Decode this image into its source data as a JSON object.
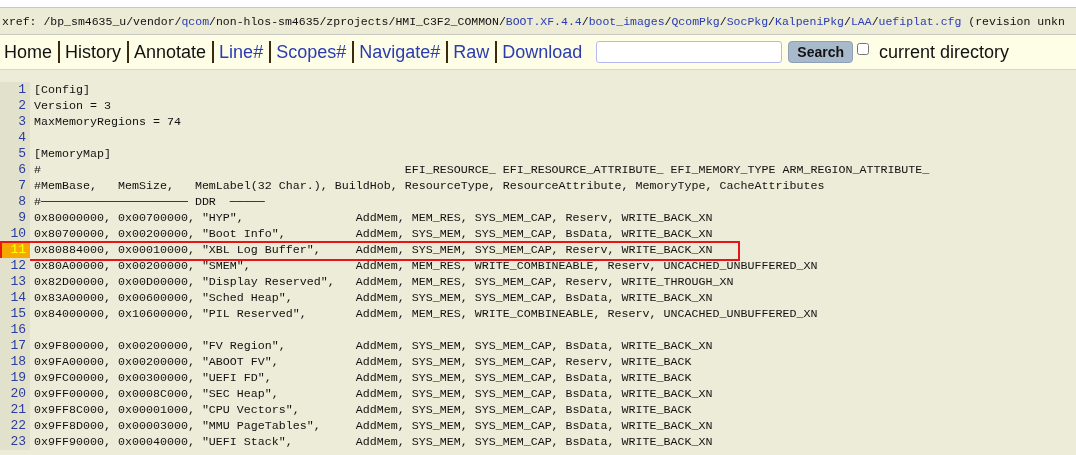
{
  "breadcrumb": [
    {
      "text": "xref: /bp_sm4635_u/vendor/",
      "link": false
    },
    {
      "text": "qcom",
      "link": true
    },
    {
      "text": "/non-hlos-sm4635/zprojects/HMI_C3F2_COMMON/",
      "link": false
    },
    {
      "text": "BOOT.XF.4.4",
      "link": true
    },
    {
      "text": "/",
      "link": false
    },
    {
      "text": "boot_images",
      "link": true
    },
    {
      "text": "/",
      "link": false
    },
    {
      "text": "QcomPkg",
      "link": true
    },
    {
      "text": "/",
      "link": false
    },
    {
      "text": "SocPkg",
      "link": true
    },
    {
      "text": "/",
      "link": false
    },
    {
      "text": "KalpeniPkg",
      "link": true
    },
    {
      "text": "/",
      "link": false
    },
    {
      "text": "LAA",
      "link": true
    },
    {
      "text": "/",
      "link": false
    },
    {
      "text": "uefiplat.cfg",
      "link": true
    },
    {
      "text": " (revision unkn",
      "link": false
    }
  ],
  "nav": [
    {
      "label": "Home",
      "link": false
    },
    {
      "label": "History",
      "link": false
    },
    {
      "label": "Annotate",
      "link": false
    },
    {
      "label": "Line#",
      "link": true
    },
    {
      "label": "Scopes#",
      "link": true
    },
    {
      "label": "Navigate#",
      "link": true
    },
    {
      "label": "Raw",
      "link": true
    },
    {
      "label": "Download",
      "link": true
    }
  ],
  "search": {
    "button": "Search",
    "checkbox_label": "current directory",
    "checked": false
  },
  "lines": [
    {
      "num": "1",
      "text": "[Config]",
      "selected": false,
      "marked": false
    },
    {
      "num": "2",
      "text": "Version = 3",
      "selected": false,
      "marked": false
    },
    {
      "num": "3",
      "text": "MaxMemoryRegions = 74",
      "selected": false,
      "marked": false
    },
    {
      "num": "4",
      "selected": false,
      "marked": false
    },
    {
      "num": "5",
      "text": "[MemoryMap]",
      "selected": false,
      "marked": false
    },
    {
      "num": "6",
      "text": "#                                                    EFI_RESOURCE_ EFI_RESOURCE_ATTRIBUTE_ EFI_MEMORY_TYPE ARM_REGION_ATTRIBUTE_",
      "selected": false,
      "marked": false
    },
    {
      "num": "7",
      "text": "#MemBase,   MemSize,   MemLabel(32 Char.), BuildHob, ResourceType, ResourceAttribute, MemoryType, CacheAttributes",
      "selected": false,
      "marked": false
    },
    {
      "num": "8",
      "text": "#───────────────────── DDR  ─────",
      "selected": false,
      "marked": false
    },
    {
      "num": "9",
      "text": "0x80000000, 0x00700000, \"HYP\",                AddMem, MEM_RES, SYS_MEM_CAP, Reserv, WRITE_BACK_XN",
      "selected": false,
      "marked": false
    },
    {
      "num": "10",
      "text": "0x80700000, 0x00200000, \"Boot Info\",          AddMem, SYS_MEM, SYS_MEM_CAP, BsData, WRITE_BACK_XN",
      "selected": false,
      "marked": false
    },
    {
      "num": "11",
      "text": "0x80884000, 0x00010000, \"XBL Log Buffer\",     AddMem, SYS_MEM, SYS_MEM_CAP, Reserv, WRITE_BACK_XN",
      "selected": true,
      "marked": true
    },
    {
      "num": "12",
      "text": "0x80A00000, 0x00200000, \"SMEM\",               AddMem, MEM_RES, WRITE_COMBINEABLE, Reserv, UNCACHED_UNBUFFERED_XN",
      "selected": false,
      "marked": false
    },
    {
      "num": "13",
      "text": "0x82D00000, 0x00D00000, \"Display Reserved\",   AddMem, MEM_RES, SYS_MEM_CAP, Reserv, WRITE_THROUGH_XN",
      "selected": false,
      "marked": false
    },
    {
      "num": "14",
      "text": "0x83A00000, 0x00600000, \"Sched Heap\",         AddMem, SYS_MEM, SYS_MEM_CAP, BsData, WRITE_BACK_XN",
      "selected": false,
      "marked": false
    },
    {
      "num": "15",
      "text": "0x84000000, 0x10600000, \"PIL Reserved\",       AddMem, MEM_RES, WRITE_COMBINEABLE, Reserv, UNCACHED_UNBUFFERED_XN",
      "selected": false,
      "marked": false
    },
    {
      "num": "16",
      "selected": false,
      "marked": false
    },
    {
      "num": "17",
      "text": "0x9F800000, 0x00200000, \"FV Region\",          AddMem, SYS_MEM, SYS_MEM_CAP, BsData, WRITE_BACK_XN",
      "selected": false,
      "marked": false
    },
    {
      "num": "18",
      "text": "0x9FA00000, 0x00200000, \"ABOOT FV\",           AddMem, SYS_MEM, SYS_MEM_CAP, Reserv, WRITE_BACK",
      "selected": false,
      "marked": false
    },
    {
      "num": "19",
      "text": "0x9FC00000, 0x00300000, \"UEFI FD\",            AddMem, SYS_MEM, SYS_MEM_CAP, BsData, WRITE_BACK",
      "selected": false,
      "marked": false
    },
    {
      "num": "20",
      "text": "0x9FF00000, 0x0008C000, \"SEC Heap\",           AddMem, SYS_MEM, SYS_MEM_CAP, BsData, WRITE_BACK_XN",
      "selected": false,
      "marked": false
    },
    {
      "num": "21",
      "text": "0x9FF8C000, 0x00001000, \"CPU Vectors\",        AddMem, SYS_MEM, SYS_MEM_CAP, BsData, WRITE_BACK",
      "selected": false,
      "marked": false
    },
    {
      "num": "22",
      "text": "0x9FF8D000, 0x00003000, \"MMU PageTables\",     AddMem, SYS_MEM, SYS_MEM_CAP, BsData, WRITE_BACK_XN",
      "selected": false,
      "marked": false
    },
    {
      "num": "23",
      "text": "0x9FF90000, 0x00040000, \"UEFI Stack\",         AddMem, SYS_MEM, SYS_MEM_CAP, BsData, WRITE_BACK_XN",
      "selected": false,
      "marked": false
    }
  ]
}
